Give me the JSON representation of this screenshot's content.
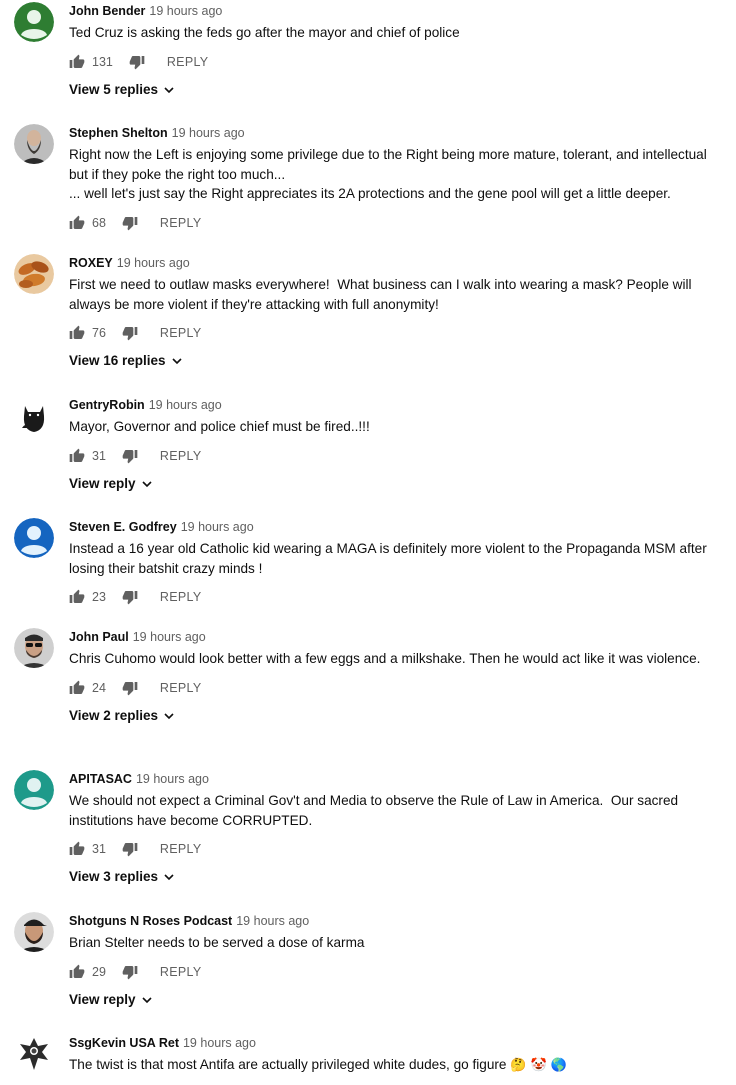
{
  "comments": [
    {
      "author": "John Bender",
      "time": "19 hours ago",
      "text": "Ted Cruz is asking the feds go after the mayor and chief of police",
      "likes": "131",
      "reply_label": "REPLY",
      "replies_label": "View 5 replies",
      "avatar_icon": "person-placeholder-icon",
      "avatar_color": "#2e7d32"
    },
    {
      "author": "Stephen Shelton",
      "time": "19 hours ago",
      "text": "Right now the Left is enjoying some privilege due to the Right being more mature, tolerant, and intellectual but if they poke the right too much...\n... well let's just say the Right appreciates its 2A protections and the gene pool will get a little deeper.",
      "likes": "68",
      "reply_label": "REPLY",
      "replies_label": "",
      "avatar_icon": "bearded-man-photo-icon",
      "avatar_color": "#9e9e9e"
    },
    {
      "author": "ROXEY",
      "time": "19 hours ago",
      "text": "First we need to outlaw masks everywhere!  What business can I walk into wearing a mask? People will always be more violent if they're attacking with full anonymity!",
      "likes": "76",
      "reply_label": "REPLY",
      "replies_label": "View 16 replies",
      "avatar_icon": "food-photo-icon",
      "avatar_color": "#c77a2e"
    },
    {
      "author": "GentryRobin",
      "time": "19 hours ago",
      "text": "Mayor, Governor and police chief must be fired..!!!",
      "likes": "31",
      "reply_label": "REPLY",
      "replies_label": "View reply",
      "avatar_icon": "black-cat-icon",
      "avatar_color": "#ffffff"
    },
    {
      "author": "Steven E. Godfrey",
      "time": "19 hours ago",
      "text": "Instead a 16 year old Catholic kid wearing a MAGA is definitely more violent to the Propaganda MSM after losing their batshit crazy minds !",
      "likes": "23",
      "reply_label": "REPLY",
      "replies_label": "",
      "avatar_icon": "person-placeholder-icon",
      "avatar_color": "#1565c0"
    },
    {
      "author": "John Paul",
      "time": "19 hours ago",
      "text": "Chris Cuhomo would look better with a few eggs and a milkshake. Then he would act like it was violence.",
      "likes": "24",
      "reply_label": "REPLY",
      "replies_label": "View 2 replies",
      "avatar_icon": "man-sunglasses-photo-icon",
      "avatar_color": "#8d8d8d"
    },
    {
      "author": "APITASAC",
      "time": "19 hours ago",
      "text": "We should not expect a Criminal Gov't and Media to observe the Rule of Law in America.  Our sacred institutions have become CORRUPTED.",
      "likes": "31",
      "reply_label": "REPLY",
      "replies_label": "View 3 replies",
      "avatar_icon": "person-placeholder-icon",
      "avatar_color": "#1e9a8a"
    },
    {
      "author": "Shotguns N Roses Podcast",
      "time": "19 hours ago",
      "text": "Brian Stelter needs to be served a dose of karma",
      "likes": "29",
      "reply_label": "REPLY",
      "replies_label": "View reply",
      "avatar_icon": "bearded-man-cap-photo-icon",
      "avatar_color": "#5d5d5d"
    },
    {
      "author": "SsgKevin USA Ret",
      "time": "19 hours ago",
      "text": "The twist is that most Antifa are actually privileged white dudes, go figure",
      "emoji_text": "🤔 🤡 🌎",
      "likes": "",
      "reply_label": "",
      "replies_label": "",
      "avatar_icon": "eagle-emblem-icon",
      "avatar_color": "#333333"
    }
  ]
}
